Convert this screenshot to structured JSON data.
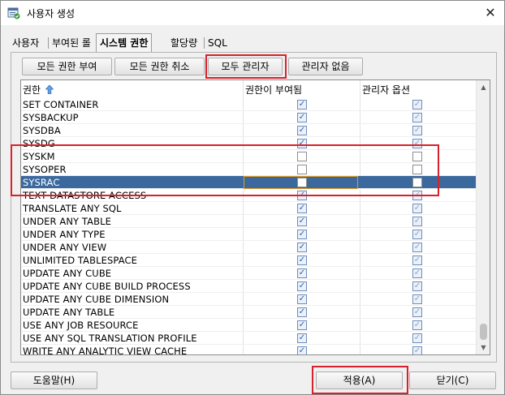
{
  "window": {
    "title": "사용자 생성",
    "app_icon": "database-user-icon",
    "close_glyph": "✕"
  },
  "tabs": [
    {
      "label": "사용자",
      "active": false
    },
    {
      "label": "부여된 롤",
      "active": false
    },
    {
      "label": "시스템 권한",
      "active": true
    },
    {
      "label": "할당량",
      "active": false
    },
    {
      "label": "SQL",
      "active": false
    }
  ],
  "toolbar": {
    "grant_all": "모든 권한 부여",
    "revoke_all": "모든 권한 취소",
    "all_admin": "모두 관리자",
    "no_admin": "관리자 없음"
  },
  "grid": {
    "columns": {
      "privilege": "권한",
      "granted": "권한이 부여됨",
      "admin_option": "관리자 옵션"
    },
    "sort_icon": "sort-ascending-icon",
    "rows": [
      {
        "name": "SET CONTAINER",
        "granted": true,
        "admin": true
      },
      {
        "name": "SYSBACKUP",
        "granted": true,
        "admin": true
      },
      {
        "name": "SYSDBA",
        "granted": true,
        "admin": true
      },
      {
        "name": "SYSDG",
        "granted": true,
        "admin": true
      },
      {
        "name": "SYSKM",
        "granted": false,
        "admin": false
      },
      {
        "name": "SYSOPER",
        "granted": false,
        "admin": false
      },
      {
        "name": "SYSRAC",
        "granted": false,
        "admin": false,
        "selected": true
      },
      {
        "name": "TEXT DATASTORE ACCESS",
        "granted": true,
        "admin": true
      },
      {
        "name": "TRANSLATE ANY SQL",
        "granted": true,
        "admin": true
      },
      {
        "name": "UNDER ANY TABLE",
        "granted": true,
        "admin": true
      },
      {
        "name": "UNDER ANY TYPE",
        "granted": true,
        "admin": true
      },
      {
        "name": "UNDER ANY VIEW",
        "granted": true,
        "admin": true
      },
      {
        "name": "UNLIMITED TABLESPACE",
        "granted": true,
        "admin": true
      },
      {
        "name": "UPDATE ANY CUBE",
        "granted": true,
        "admin": true
      },
      {
        "name": "UPDATE ANY CUBE BUILD PROCESS",
        "granted": true,
        "admin": true
      },
      {
        "name": "UPDATE ANY CUBE DIMENSION",
        "granted": true,
        "admin": true
      },
      {
        "name": "UPDATE ANY TABLE",
        "granted": true,
        "admin": true
      },
      {
        "name": "USE ANY JOB RESOURCE",
        "granted": true,
        "admin": true
      },
      {
        "name": "USE ANY SQL TRANSLATION PROFILE",
        "granted": true,
        "admin": true
      },
      {
        "name": "WRITE ANY ANALYTIC VIEW CACHE",
        "granted": true,
        "admin": true
      }
    ]
  },
  "footer": {
    "help": "도움말(H)",
    "apply": "적용(A)",
    "close": "닫기(C)"
  },
  "colors": {
    "selection": "#3b699e",
    "highlight_box": "#d9212b",
    "focus_cell": "#e59b1f"
  }
}
